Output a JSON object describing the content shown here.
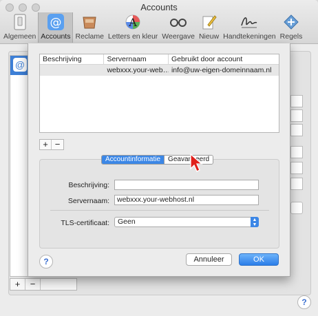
{
  "window": {
    "title": "Accounts"
  },
  "toolbar": {
    "items": [
      {
        "label": "Algemeen",
        "icon": "switch-icon"
      },
      {
        "label": "Accounts",
        "icon": "at-sign-icon",
        "active": true
      },
      {
        "label": "Reclame",
        "icon": "junk-mail-icon"
      },
      {
        "label": "Letters en kleur",
        "icon": "fonts-colors-icon"
      },
      {
        "label": "Weergave",
        "icon": "glasses-icon"
      },
      {
        "label": "Nieuw",
        "icon": "pencil-icon"
      },
      {
        "label": "Handtekeningen",
        "icon": "signature-icon"
      },
      {
        "label": "Regels",
        "icon": "rules-icon"
      }
    ]
  },
  "sidebar": {
    "account_icon": "@",
    "add": "+",
    "remove": "−"
  },
  "sheet": {
    "table": {
      "columns": [
        "Beschrijving",
        "Servernaam",
        "Gebruikt door account"
      ],
      "rows": [
        {
          "description": "",
          "server": "webxxx.your-web…",
          "used_by": "info@uw-eigen-domeinnaam.nl"
        }
      ]
    },
    "add": "+",
    "remove": "−",
    "tabs": [
      {
        "label": "Accountinformatie",
        "selected": true
      },
      {
        "label": "Geavanceerd",
        "selected": false
      }
    ],
    "form": {
      "description_label": "Beschrijving:",
      "description_value": "",
      "server_label": "Servernaam:",
      "server_value": "webxxx.your-webhost.nl",
      "tls_label": "TLS-certificaat:",
      "tls_value": "Geen"
    },
    "help": "?",
    "cancel_label": "Annuleer",
    "ok_label": "OK"
  },
  "help": "?",
  "colors": {
    "accent": "#3c87e6",
    "cursor": "#e0201b"
  }
}
